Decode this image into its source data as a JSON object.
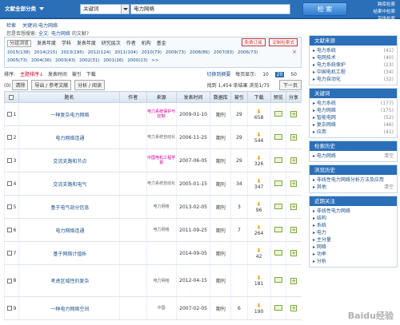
{
  "topbar": {
    "scope_label": "文献全部分类",
    "field_label": "关键词",
    "query": "电力网络",
    "search_label": "检 索",
    "links": [
      "跨库检索",
      "结果中检索",
      "高级检索"
    ]
  },
  "subnav": [
    "检索",
    "关键词:电力网络"
  ],
  "hint": {
    "prefix": "您是否想搜索:",
    "link": "全文: 电力网络",
    "suffix": "的文献?"
  },
  "filters": {
    "tabs": [
      "分组浏览",
      "发表年度",
      "学科",
      "发表年度",
      "研究层次",
      "作者",
      "机构",
      "基金"
    ],
    "buttons": [
      "免费订阅",
      "定制检索式"
    ],
    "years": [
      "2015(138)",
      "2014(215)",
      "2013(195)",
      "2012(124)",
      "2011(104)",
      "2010(79)",
      "2009(73)",
      "2008(86)",
      "2007(83)",
      "2006(73)",
      "2005(73)",
      "2004(36)",
      "2003(43)",
      "2002(31)",
      "2001(26)",
      "2000(23)",
      ">>"
    ],
    "close": "×"
  },
  "sortbar": {
    "label": "排序:",
    "options": [
      "主题排序↓",
      "发表时间",
      "被引",
      "下载"
    ],
    "right": "切换到摘要",
    "per_page_label": "每页显示:",
    "per_page": [
      "10",
      "20",
      "50"
    ]
  },
  "toolbar": {
    "selected": "(0)",
    "buttons": [
      "清除",
      "导出 / 参考文献",
      "分析 / 阅读"
    ],
    "found": "找到 1,454 条结果",
    "pages": "浏览1/75",
    "next": "下一页"
  },
  "table": {
    "headers": [
      "",
      "题名",
      "作者",
      "来源",
      "发表时间",
      "数据库",
      "被引",
      "下载",
      "预览",
      "分享"
    ],
    "rows": [
      {
        "num": "1",
        "title": "一种复杂电力网络",
        "author": "",
        "source": "电力系统保护与控制",
        "date": "2009-01-10",
        "db": "期刊",
        "cited": "29",
        "downloads": "658"
      },
      {
        "num": "2",
        "title": "电力网络连通",
        "author": "",
        "source": "电力系统自动化",
        "date": "2006-11-25",
        "db": "期刊",
        "cited": "29",
        "downloads": "544"
      },
      {
        "num": "3",
        "title": "交流支路和节点",
        "author": "",
        "source": "中国电机工程学报",
        "date": "2007-06-05",
        "db": "期刊",
        "cited": "29",
        "downloads": "326"
      },
      {
        "num": "4",
        "title": "交流支路和电气",
        "author": "",
        "source": "电力系统自动化",
        "date": "2005-01-15",
        "db": "期刊",
        "cited": "34",
        "downloads": "347"
      },
      {
        "num": "5",
        "title": "基于电气剖分信息",
        "author": "",
        "source": "电力网络",
        "date": "2013-02-05",
        "db": "期刊",
        "cited": "3",
        "downloads": "96"
      },
      {
        "num": "6",
        "title": "电力网络连通",
        "author": "",
        "source": "电力网络",
        "date": "2011-09-25",
        "db": "期刊",
        "cited": "7",
        "downloads": "264"
      },
      {
        "num": "7",
        "title": "基于网络计值析",
        "author": "",
        "source": "",
        "date": "2014-09-05",
        "db": "期刊",
        "cited": "",
        "downloads": "42"
      },
      {
        "num": "8",
        "title": "考虑区域性的复杂",
        "author": "",
        "source": "电力网络",
        "date": "2012-04-15",
        "db": "期刊",
        "cited": "",
        "downloads": "181"
      },
      {
        "num": "9",
        "title": "一种电力网络空间",
        "author": "",
        "source": "中国",
        "date": "2007-02-05",
        "db": "期刊",
        "cited": "6",
        "downloads": "190"
      }
    ]
  },
  "sidebar": {
    "panels": [
      {
        "title": "文献来源",
        "items": [
          [
            "电力系统",
            "(41)"
          ],
          [
            "电网技术",
            "(40)"
          ],
          [
            "电力系统保护",
            "(23)"
          ],
          [
            "中国电机工程",
            "(34)"
          ],
          [
            "电力自动化",
            "(32)"
          ]
        ]
      },
      {
        "title": "关键词",
        "items": [
          [
            "电力系统",
            "(177)"
          ],
          [
            "电力网络",
            "(175)"
          ],
          [
            "智能电网",
            "(52)"
          ],
          [
            "复杂网络",
            "(46)"
          ],
          [
            "应用",
            "(41)"
          ]
        ]
      },
      {
        "title": "检索历史",
        "items": [
          [
            "电力网络",
            "清空"
          ]
        ]
      },
      {
        "title": "浏览历史",
        "items": [
          [
            "非线性电力网络分析方法及应用",
            ""
          ],
          [
            "其他",
            "清空"
          ]
        ]
      },
      {
        "title": "近期关注",
        "items": [
          [
            "非线性电力网络",
            ""
          ],
          [
            "结构",
            ""
          ],
          [
            "系统",
            ""
          ],
          [
            "电力",
            ""
          ],
          [
            "主分量",
            ""
          ],
          [
            "网络",
            ""
          ],
          [
            "功率",
            ""
          ],
          [
            "分析",
            ""
          ]
        ]
      }
    ]
  },
  "watermark": "Baidu经验"
}
